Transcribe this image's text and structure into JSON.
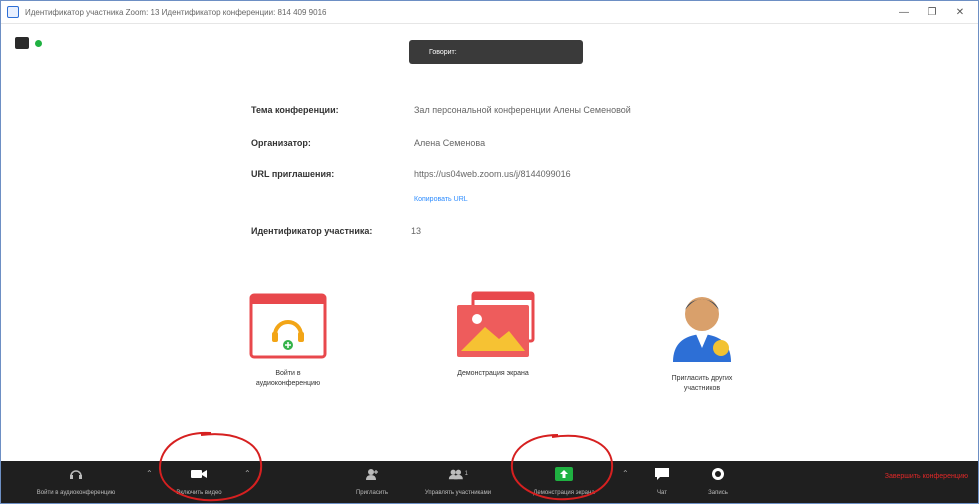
{
  "window": {
    "title": "Идентификатор участника Zoom: 13    Идентификатор конференции: 814 409 9016",
    "controls": [
      "—",
      "❐",
      "✕"
    ]
  },
  "speaker_pill": "Говорит:",
  "info": {
    "topic_label": "Тема конференции:",
    "topic_value": "Зал персональной конференции Алены Семеновой",
    "host_label": "Организатор:",
    "host_value": "Алена Семенова",
    "url_label": "URL приглашения:",
    "url_value": "https://us04web.zoom.us/j/8144099016",
    "copy_url": "Копировать URL",
    "participant_label": "Идентификатор участника:",
    "participant_value": "13"
  },
  "features": [
    {
      "label_line1": "Войти в",
      "label_line2": "аудиоконференцию"
    },
    {
      "label_line1": "Демонстрация экрана",
      "label_line2": ""
    },
    {
      "label_line1": "Пригласить других",
      "label_line2": "участников"
    }
  ],
  "toolbar": {
    "audio": "Войти в аудиоконференцию",
    "video": "Включить видео",
    "invite": "Пригласить",
    "participants": "Управлять участниками",
    "participants_count": "1",
    "share": "Демонстрация экрана",
    "chat": "Чат",
    "record": "Запись",
    "end": "Завершить конференцию"
  },
  "colors": {
    "accent_green": "#1fb141",
    "feature_red": "#e8484c",
    "link_blue": "#2d8cff",
    "annotation_red": "#d62020"
  }
}
